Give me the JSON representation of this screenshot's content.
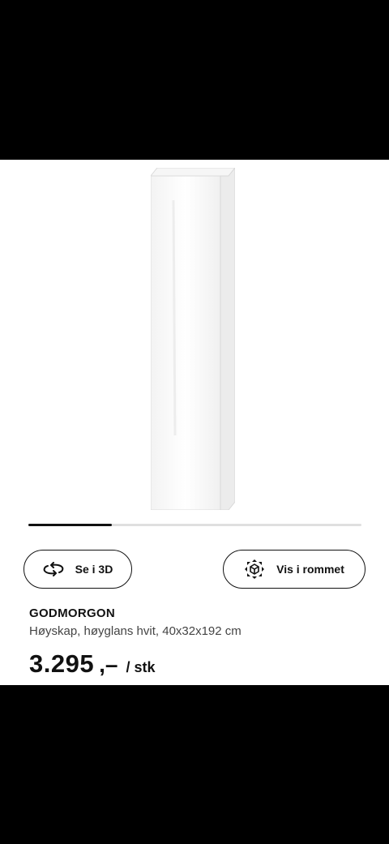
{
  "product": {
    "name": "GODMORGON",
    "description": "Høyskap, høyglans hvit, 40x32x192 cm",
    "price_integer": "3.295",
    "price_decimal": ",–",
    "price_unit": "/ stk"
  },
  "actions": {
    "view_3d_label": "Se i 3D",
    "view_room_label": "Vis i rommet"
  },
  "carousel": {
    "progress": 0.25
  },
  "icons": {
    "view_3d": "rotate-3d-icon",
    "view_room": "ar-room-icon"
  },
  "colors": {
    "text": "#111111",
    "secondary_text": "#444444",
    "track": "#dfdfdf",
    "background": "#ffffff"
  }
}
